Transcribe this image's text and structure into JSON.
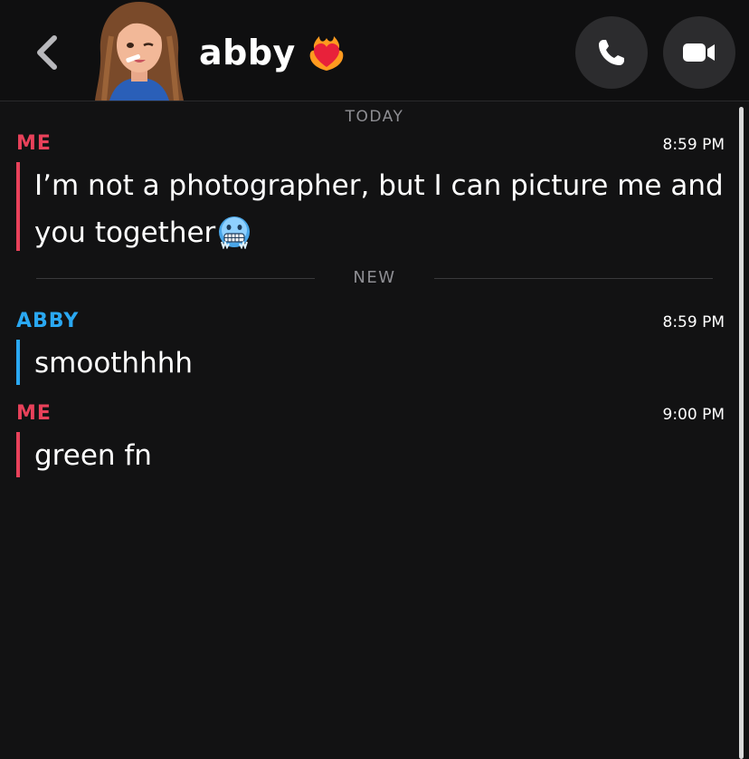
{
  "header": {
    "contact_name": "abby",
    "name_emoji": "heart-on-fire",
    "back_icon": "chevron-left-icon",
    "call_icon": "phone-icon",
    "video_icon": "video-camera-icon"
  },
  "conversation": {
    "day_label": "TODAY",
    "new_label": "NEW",
    "messages": [
      {
        "sender": "ME",
        "time": "8:59 PM",
        "text_line1": "I’m not a photographer, but I can picture me and",
        "text_line2": "you together",
        "emoji": "freezing-face"
      },
      {
        "sender": "ABBY",
        "time": "8:59 PM",
        "text": "smoothhhh"
      },
      {
        "sender": "ME",
        "time": "9:00 PM",
        "text": "green fn"
      }
    ]
  },
  "colors": {
    "me": "#e8415a",
    "abby": "#2aa8f2",
    "background": "#121213",
    "button": "#2c2c2e"
  }
}
